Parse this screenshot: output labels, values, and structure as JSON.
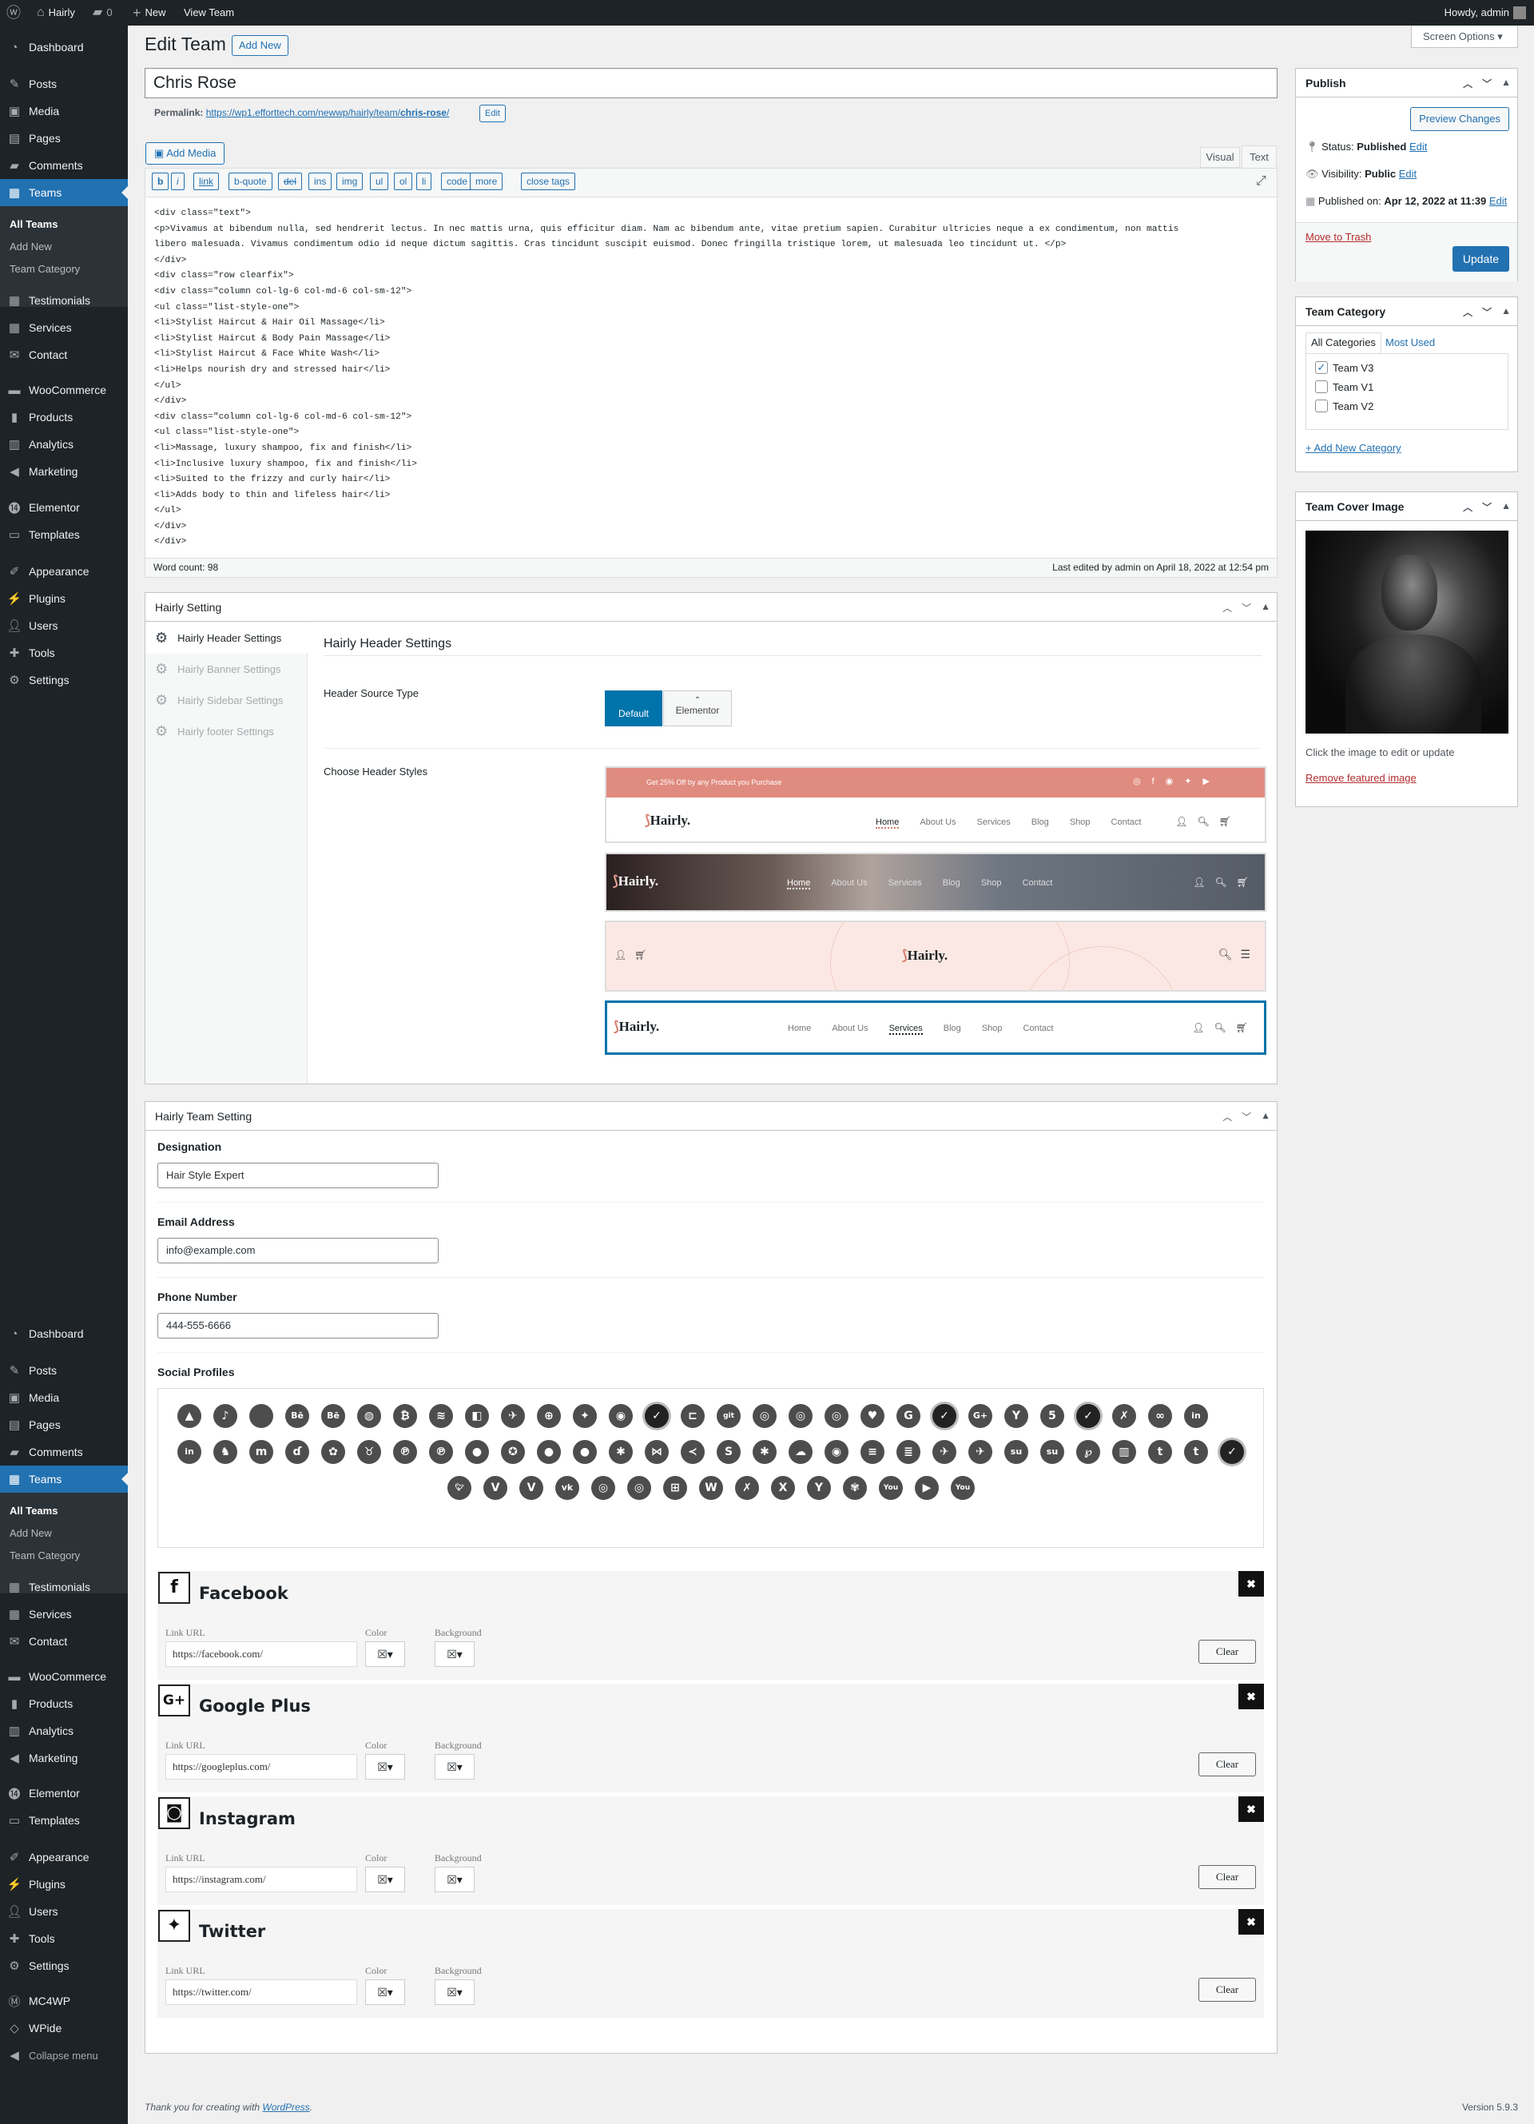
{
  "admin_bar": {
    "site": "Hairly",
    "comments": "0",
    "new": "New",
    "view": "View Team",
    "howdy": "Howdy, admin"
  },
  "menu": {
    "dashboard": "Dashboard",
    "posts": "Posts",
    "media": "Media",
    "pages": "Pages",
    "comments": "Comments",
    "teams": "Teams",
    "sub_all": "All Teams",
    "sub_new": "Add New",
    "sub_cat": "Team Category",
    "testimonials": "Testimonials",
    "services": "Services",
    "contact": "Contact",
    "woocommerce": "WooCommerce",
    "products": "Products",
    "analytics": "Analytics",
    "marketing": "Marketing",
    "elementor": "Elementor",
    "templates": "Templates",
    "appearance": "Appearance",
    "plugins": "Plugins",
    "users": "Users",
    "tools": "Tools",
    "settings": "Settings",
    "mc4wp": "MC4WP",
    "wpide": "WPide",
    "collapse": "Collapse menu"
  },
  "screen_options": "Screen Options",
  "page": {
    "title": "Edit Team",
    "add_new": "Add New",
    "post_title": "Chris Rose",
    "permalink_label": "Permalink:",
    "permalink_base": "https://wp1.efforttech.com/newwp/hairly/team/",
    "permalink_slug": "chris-rose",
    "permalink_end": "/",
    "edit": "Edit"
  },
  "editor": {
    "add_media": "Add Media",
    "tab_visual": "Visual",
    "tab_text": "Text",
    "buttons": [
      "b",
      "i",
      "link",
      "b-quote",
      "del",
      "ins",
      "img",
      "ul",
      "ol",
      "li",
      "code",
      "more",
      "close tags"
    ],
    "lines": [
      "<div class=\"text\">",
      "<p>Vivamus at bibendum nulla, sed hendrerit lectus. In nec mattis urna, quis efficitur diam. Nam ac bibendum ante, vitae pretium sapien. Curabitur ultricies neque a ex condimentum, non mattis",
      "libero malesuada. Vivamus condimentum odio id neque dictum sagittis. Cras tincidunt suscipit euismod. Donec fringilla tristique lorem, ut malesuada leo tincidunt ut. </p>",
      "</div>",
      "<div class=\"row clearfix\">",
      "<div class=\"column col-lg-6 col-md-6 col-sm-12\">",
      "<ul class=\"list-style-one\">",
      "<li>Stylist Haircut & Hair Oil Massage</li>",
      "<li>Stylist Haircut & Body Pain Massage</li>",
      "<li>Stylist Haircut & Face White Wash</li>",
      "<li>Helps nourish dry and stressed hair</li>",
      "</ul>",
      "</div>",
      "<div class=\"column col-lg-6 col-md-6 col-sm-12\">",
      "<ul class=\"list-style-one\">",
      "<li>Massage, luxury shampoo, fix and finish</li>",
      "<li>Inclusive luxury shampoo, fix and finish</li>",
      "<li>Suited to the frizzy and curly hair</li>",
      "<li>Adds body to thin and lifeless hair</li>",
      "</ul>",
      "</div>",
      "</div>"
    ],
    "word_count": "Word count: 98",
    "last_edited": "Last edited by admin on April 18, 2022 at 12:54 pm"
  },
  "publish": {
    "title": "Publish",
    "preview": "Preview Changes",
    "status_label": "Status:",
    "status": "Published",
    "visibility_label": "Visibility:",
    "visibility": "Public",
    "published_label": "Published on:",
    "published": "Apr 12, 2022 at 11:39",
    "edit": "Edit",
    "trash": "Move to Trash",
    "update": "Update"
  },
  "category": {
    "title": "Team Category",
    "tab_all": "All Categories",
    "tab_used": "Most Used",
    "items": [
      "Team V3",
      "Team V1",
      "Team V2"
    ],
    "add": "+ Add New Category"
  },
  "cover": {
    "title": "Team Cover Image",
    "hint": "Click the image to edit or update",
    "remove": "Remove featured image"
  },
  "hairly_setting": {
    "title": "Hairly Setting",
    "tabs": [
      "Hairly Header Settings",
      "Hairly Banner Settings",
      "Hairly Sidebar Settings",
      "Hairly footer Settings"
    ],
    "panel_title": "Hairly Header Settings",
    "source_label": "Header Source Type",
    "source_default": "Default",
    "source_elementor": "Elementor",
    "styles_label": "Choose Header Styles",
    "promo": "Get 25% Off by any Product you Purchase",
    "logo": "Hairly.",
    "nav": [
      "Home",
      "About Us",
      "Services",
      "Blog",
      "Shop",
      "Contact"
    ]
  },
  "team_setting": {
    "title": "Hairly Team Setting",
    "designation_label": "Designation",
    "designation": "Hair Style Expert",
    "email_label": "Email Address",
    "email": "info@example.com",
    "phone_label": "Phone Number",
    "phone": "444-555-6666",
    "social_label": "Social Profiles",
    "url_label": "Link URL",
    "color_label": "Color",
    "bg_label": "Background",
    "clear": "Clear",
    "profiles": [
      {
        "name": "Facebook",
        "url": "https://facebook.com/",
        "icon": "f"
      },
      {
        "name": "Google Plus",
        "url": "https://googleplus.com/",
        "icon": "G+"
      },
      {
        "name": "Instagram",
        "url": "https://instagram.com/",
        "icon": "◙"
      },
      {
        "name": "Twitter",
        "url": "https://twitter.com/",
        "icon": "✦"
      }
    ]
  },
  "footer": {
    "thanks": "Thank you for creating with ",
    "wp": "WordPress",
    "version": "Version 5.9.3"
  }
}
